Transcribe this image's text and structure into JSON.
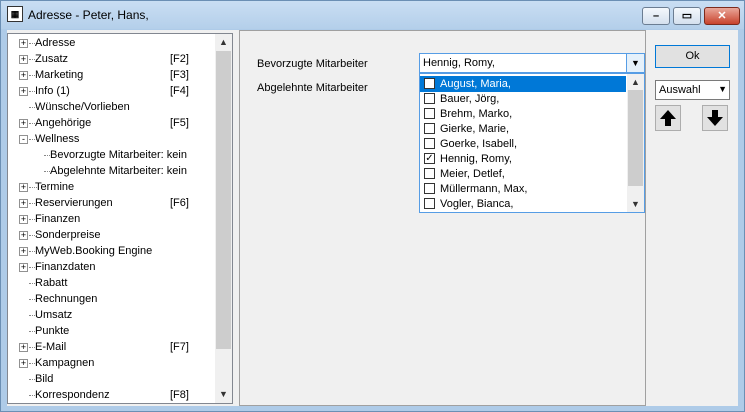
{
  "window": {
    "title": "Adresse - Peter, Hans,",
    "app_icon": "address-card-icon"
  },
  "tree": {
    "items": [
      {
        "label": "Adresse",
        "key": "",
        "expander": "+",
        "indent": 0
      },
      {
        "label": "Zusatz",
        "key": "[F2]",
        "expander": "+",
        "indent": 0
      },
      {
        "label": "Marketing",
        "key": "[F3]",
        "expander": "+",
        "indent": 0
      },
      {
        "label": "Info (1)",
        "key": "[F4]",
        "expander": "+",
        "indent": 0
      },
      {
        "label": "Wünsche/Vorlieben",
        "key": "",
        "expander": "",
        "indent": 0
      },
      {
        "label": "Angehörige",
        "key": "[F5]",
        "expander": "+",
        "indent": 0
      },
      {
        "label": "Wellness",
        "key": "",
        "expander": "-",
        "indent": 0
      },
      {
        "label": "Bevorzugte Mitarbeiter: kein",
        "key": "",
        "expander": "",
        "indent": 1
      },
      {
        "label": "Abgelehnte Mitarbeiter: kein",
        "key": "",
        "expander": "",
        "indent": 1
      },
      {
        "label": "Termine",
        "key": "",
        "expander": "+",
        "indent": 0
      },
      {
        "label": "Reservierungen",
        "key": "[F6]",
        "expander": "+",
        "indent": 0
      },
      {
        "label": "Finanzen",
        "key": "",
        "expander": "+",
        "indent": 0
      },
      {
        "label": "Sonderpreise",
        "key": "",
        "expander": "+",
        "indent": 0
      },
      {
        "label": "MyWeb.Booking Engine",
        "key": "",
        "expander": "+",
        "indent": 0
      },
      {
        "label": "Finanzdaten",
        "key": "",
        "expander": "+",
        "indent": 0
      },
      {
        "label": "Rabatt",
        "key": "",
        "expander": "",
        "indent": 0
      },
      {
        "label": "Rechnungen",
        "key": "",
        "expander": "",
        "indent": 0
      },
      {
        "label": "Umsatz",
        "key": "",
        "expander": "",
        "indent": 0
      },
      {
        "label": "Punkte",
        "key": "",
        "expander": "",
        "indent": 0
      },
      {
        "label": "E-Mail",
        "key": "[F7]",
        "expander": "+",
        "indent": 0
      },
      {
        "label": "Kampagnen",
        "key": "",
        "expander": "+",
        "indent": 0
      },
      {
        "label": "Bild",
        "key": "",
        "expander": "",
        "indent": 0
      },
      {
        "label": "Korrespondenz",
        "key": "[F8]",
        "expander": "",
        "indent": 0
      }
    ]
  },
  "form": {
    "preferred_label": "Bevorzugte Mitarbeiter",
    "rejected_label": "Abgelehnte Mitarbeiter",
    "preferred_value": "Hennig, Romy,"
  },
  "dropdown": {
    "items": [
      {
        "label": "August, Maria,",
        "checked": false,
        "selected": true
      },
      {
        "label": "Bauer, Jörg,",
        "checked": false,
        "selected": false
      },
      {
        "label": "Brehm, Marko,",
        "checked": false,
        "selected": false
      },
      {
        "label": "Gierke, Marie,",
        "checked": false,
        "selected": false
      },
      {
        "label": "Goerke, Isabell,",
        "checked": false,
        "selected": false
      },
      {
        "label": "Hennig, Romy,",
        "checked": true,
        "selected": false
      },
      {
        "label": "Meier, Detlef,",
        "checked": false,
        "selected": false
      },
      {
        "label": "Müllermann, Max,",
        "checked": false,
        "selected": false
      },
      {
        "label": "Vogler, Bianca,",
        "checked": false,
        "selected": false
      }
    ]
  },
  "actions": {
    "ok_label": "Ok",
    "auswahl_value": "Auswahl",
    "up_icon": "arrow-up-icon",
    "down_icon": "arrow-down-icon"
  },
  "colors": {
    "selection": "#0078d7",
    "title_bar": "#b4cfea"
  }
}
